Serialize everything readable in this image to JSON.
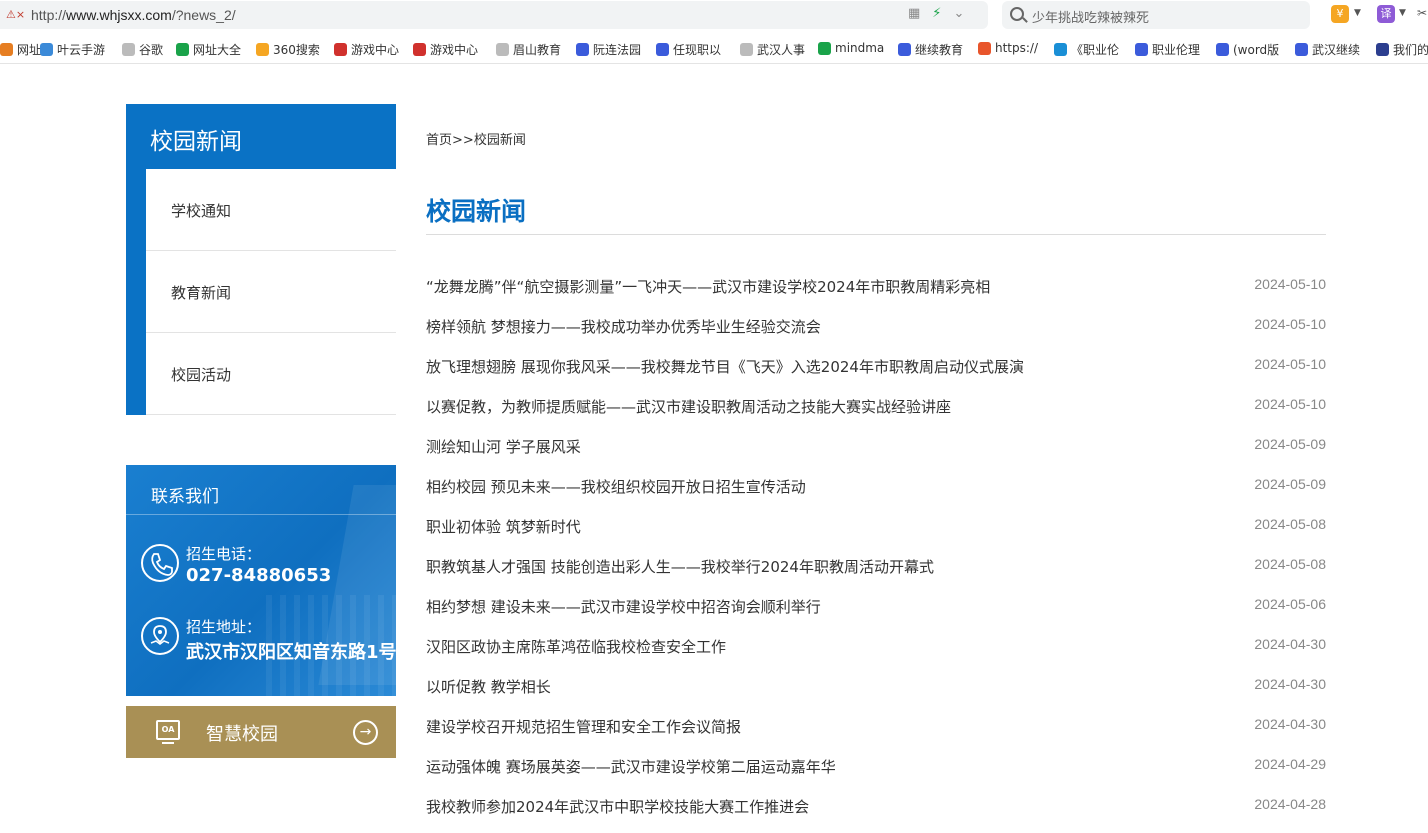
{
  "browser": {
    "url_prefix": "http://",
    "url_host": "www.whjsxx.com",
    "url_path": "/?news_2/",
    "search_placeholder": "少年挑战吃辣被辣死",
    "ext_shield": "¥",
    "ext_translate": "译"
  },
  "bookmarks": [
    {
      "label": "网址",
      "icon": "globe-icon",
      "color": "#e67e22"
    },
    {
      "label": "叶云手游",
      "icon": "cloud-icon",
      "color": "#3b8ad8"
    },
    {
      "label": "谷歌",
      "icon": "page-icon",
      "color": "#bbbbbb"
    },
    {
      "label": "网址大全",
      "icon": "plus-icon",
      "color": "#1aa34a"
    },
    {
      "label": "360搜索",
      "icon": "ring-icon",
      "color": "#f5a623"
    },
    {
      "label": "游戏中心",
      "icon": "game-icon",
      "color": "#d0312d"
    },
    {
      "label": "游戏中心",
      "icon": "game-icon",
      "color": "#d0312d"
    },
    {
      "label": "眉山教育",
      "icon": "page-icon",
      "color": "#bbbbbb"
    },
    {
      "label": "阮连法园",
      "icon": "paw-icon",
      "color": "#3b5bdb"
    },
    {
      "label": "任现职以",
      "icon": "paw-icon",
      "color": "#3b5bdb"
    },
    {
      "label": "武汉人事",
      "icon": "page-icon",
      "color": "#bbbbbb"
    },
    {
      "label": "mindma",
      "icon": "chat-icon",
      "color": "#1aa34a"
    },
    {
      "label": "继续教育",
      "icon": "paw-icon",
      "color": "#3b5bdb"
    },
    {
      "label": "https://",
      "icon": "s-icon",
      "color": "#e8552b"
    },
    {
      "label": "《职业伦",
      "icon": "book-icon",
      "color": "#1a8fd6"
    },
    {
      "label": "职业伦理",
      "icon": "paw-icon",
      "color": "#3b5bdb"
    },
    {
      "label": "(word版",
      "icon": "paw-icon",
      "color": "#3b5bdb"
    },
    {
      "label": "武汉继续",
      "icon": "paw-icon",
      "color": "#3b5bdb"
    },
    {
      "label": "我们的",
      "icon": "bar-icon",
      "color": "#2c3e8f"
    }
  ],
  "sidebar": {
    "title": "校园新闻",
    "items": [
      {
        "label": "学校通知"
      },
      {
        "label": "教育新闻"
      },
      {
        "label": "校园活动"
      }
    ]
  },
  "contact": {
    "title": "联系我们",
    "phone_label": "招生电话：",
    "phone": "027-84880653",
    "address_label": "招生地址：",
    "address": "武汉市汉阳区知音东路1号"
  },
  "portal": {
    "label": "智慧校园",
    "icon_text": "OA"
  },
  "breadcrumb": {
    "home": "首页",
    "separator": ">>",
    "current": "校园新闻"
  },
  "page_title": "校园新闻",
  "news": [
    {
      "title": "“龙舞龙腾”伴“航空摄影测量”一飞冲天——武汉市建设学校2024年市职教周精彩亮相",
      "date": "2024-05-10"
    },
    {
      "title": "榜样领航 梦想接力——我校成功举办优秀毕业生经验交流会",
      "date": "2024-05-10"
    },
    {
      "title": "放飞理想翅膀 展现你我风采——我校舞龙节目《飞天》入选2024年市职教周启动仪式展演",
      "date": "2024-05-10"
    },
    {
      "title": "以赛促教，为教师提质赋能——武汉市建设职教周活动之技能大赛实战经验讲座",
      "date": "2024-05-10"
    },
    {
      "title": "测绘知山河 学子展风采",
      "date": "2024-05-09"
    },
    {
      "title": "相约校园 预见未来——我校组织校园开放日招生宣传活动",
      "date": "2024-05-09"
    },
    {
      "title": "职业初体验 筑梦新时代",
      "date": "2024-05-08"
    },
    {
      "title": "职教筑基人才强国 技能创造出彩人生——我校举行2024年职教周活动开幕式",
      "date": "2024-05-08"
    },
    {
      "title": "相约梦想 建设未来——武汉市建设学校中招咨询会顺利举行",
      "date": "2024-05-06"
    },
    {
      "title": "汉阳区政协主席陈革鸿莅临我校检查安全工作",
      "date": "2024-04-30"
    },
    {
      "title": "以听促教 教学相长",
      "date": "2024-04-30"
    },
    {
      "title": "建设学校召开规范招生管理和安全工作会议简报",
      "date": "2024-04-30"
    },
    {
      "title": "运动强体魄 赛场展英姿——武汉市建设学校第二届运动嘉年华",
      "date": "2024-04-29"
    },
    {
      "title": "我校教师参加2024年武汉市中职学校技能大赛工作推进会",
      "date": "2024-04-28"
    }
  ],
  "colors": {
    "primary": "#0a72c5",
    "title": "#0a6fc2",
    "portal": "#a99055",
    "date": "#888888"
  }
}
